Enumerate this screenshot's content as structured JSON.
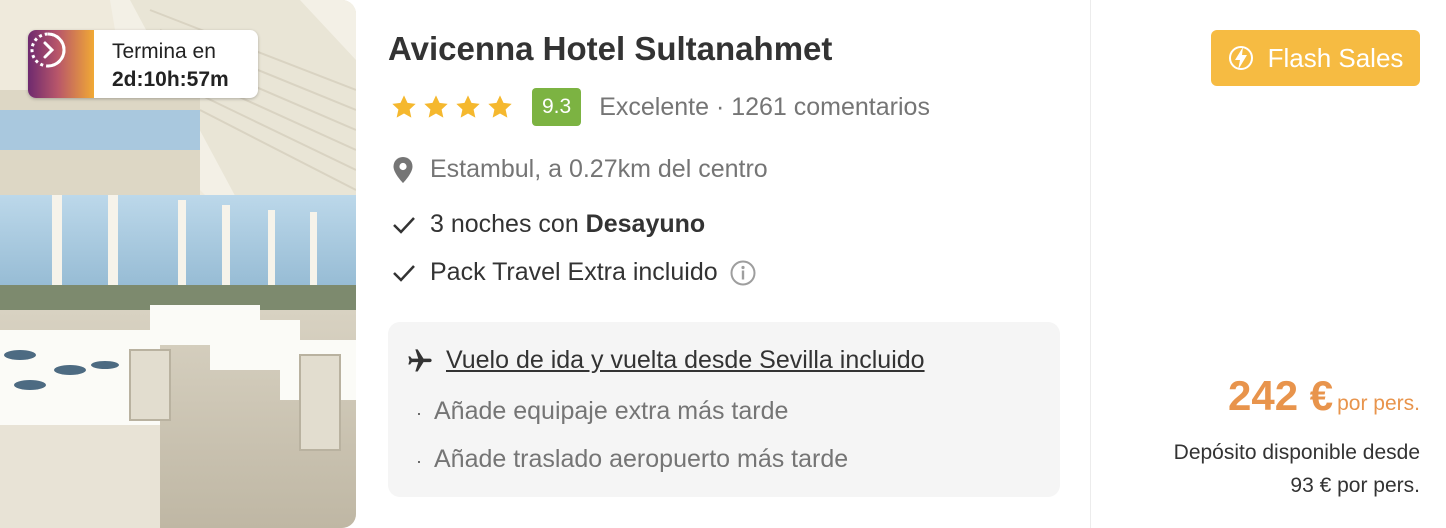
{
  "timer": {
    "label": "Termina en",
    "value": "2d:10h:57m"
  },
  "hotel": {
    "name": "Avicenna Hotel Sultanahmet",
    "stars": 4,
    "score": "9.3",
    "rating_text": "Excelente · 1261 comentarios",
    "location": "Estambul, a 0.27km del centro"
  },
  "features": {
    "nights_prefix": "3 noches con ",
    "nights_bold": "Desayuno",
    "pack": "Pack Travel Extra incluido"
  },
  "flight": {
    "link": "Vuelo de ida y vuelta desde Sevilla incluido",
    "bullet1": "Añade equipaje extra más tarde",
    "bullet2": "Añade traslado aeropuerto más tarde"
  },
  "offer": {
    "badge": "Flash Sales",
    "price": "242 €",
    "per_person": "por pers.",
    "deposit_line1": "Depósito disponible desde",
    "deposit_line2": "93 € por pers."
  },
  "colors": {
    "accent_orange": "#e8944c",
    "flash_yellow": "#f6bb42",
    "score_green": "#7cb342",
    "star_yellow": "#f5b82e"
  }
}
